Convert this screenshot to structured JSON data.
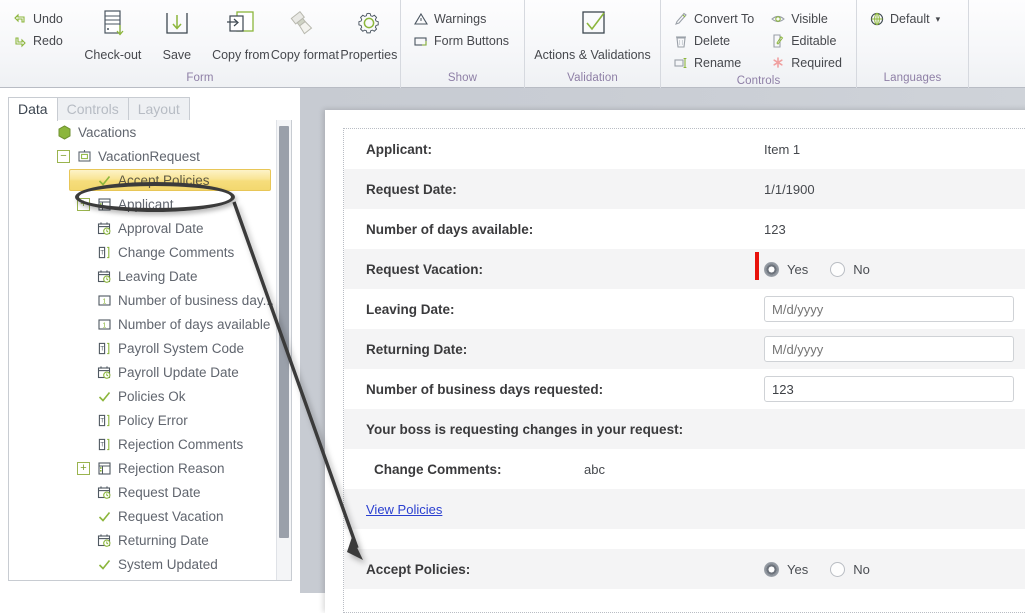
{
  "ribbon": {
    "groups": [
      {
        "caption": "Form",
        "small": [
          {
            "label": "Undo",
            "icon": "undo-icon"
          },
          {
            "label": "Redo",
            "icon": "redo-icon"
          }
        ],
        "big": [
          {
            "label": "Check-out",
            "icon": "check-out-icon"
          },
          {
            "label": "Save",
            "icon": "save-icon"
          },
          {
            "label": "Copy from",
            "icon": "copy-from-icon"
          },
          {
            "label": "Copy format",
            "icon": "copy-format-icon"
          },
          {
            "label": "Properties",
            "icon": "properties-gear-icon"
          }
        ]
      },
      {
        "caption": "Show",
        "small": [
          {
            "label": "Warnings",
            "icon": "warning-triangle-icon"
          },
          {
            "label": "Form Buttons",
            "icon": "form-buttons-icon"
          }
        ],
        "big": []
      },
      {
        "caption": "Validation",
        "small": [],
        "big": [
          {
            "label": "Actions & Validations",
            "icon": "checkmark-box-icon"
          }
        ]
      },
      {
        "caption": "Controls",
        "small": [
          {
            "label": "Convert To",
            "icon": "convert-to-icon"
          },
          {
            "label": "Delete",
            "icon": "trash-icon"
          },
          {
            "label": "Rename",
            "icon": "rename-icon"
          }
        ],
        "small2": [
          {
            "label": "Visible",
            "icon": "eye-icon"
          },
          {
            "label": "Editable",
            "icon": "editable-page-icon"
          },
          {
            "label": "Required",
            "icon": "required-asterisk-icon"
          }
        ],
        "big": []
      },
      {
        "caption": "Languages",
        "small": [
          {
            "label": "Default",
            "icon": "globe-icon",
            "dropdown": "▾"
          }
        ],
        "big": []
      }
    ]
  },
  "left_panel": {
    "tabs": [
      {
        "label": "Data",
        "active": true
      },
      {
        "label": "Controls",
        "active": false
      },
      {
        "label": "Layout",
        "active": false
      }
    ],
    "tree": [
      {
        "label": "Vacations",
        "indent": 0,
        "icon": "entity-hex-icon",
        "expander": "",
        "selected": false
      },
      {
        "label": "VacationRequest",
        "indent": 1,
        "icon": "form-icon",
        "expander": "−",
        "selected": false
      },
      {
        "label": "Accept Policies",
        "indent": 2,
        "icon": "boolean-check-icon",
        "expander": "",
        "selected": true
      },
      {
        "label": "Applicant",
        "indent": 2,
        "icon": "related-entity-icon",
        "expander": "+",
        "selected": false
      },
      {
        "label": "Approval Date",
        "indent": 2,
        "icon": "datetime-icon",
        "expander": "",
        "selected": false
      },
      {
        "label": "Change Comments",
        "indent": 2,
        "icon": "text-icon",
        "expander": "",
        "selected": false
      },
      {
        "label": "Leaving Date",
        "indent": 2,
        "icon": "datetime-icon",
        "expander": "",
        "selected": false
      },
      {
        "label": "Number of business day...",
        "indent": 2,
        "icon": "number-icon",
        "expander": "",
        "selected": false
      },
      {
        "label": "Number of days available",
        "indent": 2,
        "icon": "number-icon",
        "expander": "",
        "selected": false
      },
      {
        "label": "Payroll System Code",
        "indent": 2,
        "icon": "text-icon",
        "expander": "",
        "selected": false
      },
      {
        "label": "Payroll Update Date",
        "indent": 2,
        "icon": "datetime-icon",
        "expander": "",
        "selected": false
      },
      {
        "label": "Policies Ok",
        "indent": 2,
        "icon": "boolean-check-icon",
        "expander": "",
        "selected": false
      },
      {
        "label": "Policy Error",
        "indent": 2,
        "icon": "text-icon",
        "expander": "",
        "selected": false
      },
      {
        "label": "Rejection Comments",
        "indent": 2,
        "icon": "text-icon",
        "expander": "",
        "selected": false
      },
      {
        "label": "Rejection Reason",
        "indent": 2,
        "icon": "related-entity-icon",
        "expander": "+",
        "selected": false
      },
      {
        "label": "Request Date",
        "indent": 2,
        "icon": "datetime-icon",
        "expander": "",
        "selected": false
      },
      {
        "label": "Request Vacation",
        "indent": 2,
        "icon": "boolean-check-icon",
        "expander": "",
        "selected": false
      },
      {
        "label": "Returning Date",
        "indent": 2,
        "icon": "datetime-icon",
        "expander": "",
        "selected": false
      },
      {
        "label": "System Updated",
        "indent": 2,
        "icon": "boolean-check-icon",
        "expander": "",
        "selected": false
      }
    ]
  },
  "form": {
    "rows": [
      {
        "label": "Applicant:",
        "type": "text",
        "value": "Item 1",
        "alt": false
      },
      {
        "label": "Request Date:",
        "type": "text",
        "value": "1/1/1900",
        "alt": true
      },
      {
        "label": "Number of days available:",
        "type": "text",
        "value": "123",
        "alt": false
      },
      {
        "label": "Request Vacation:",
        "type": "radio",
        "selected": "Yes",
        "required": true,
        "alt": true
      },
      {
        "label": "Leaving Date:",
        "type": "input",
        "value": "",
        "placeholder": "M/d/yyyy",
        "alt": false
      },
      {
        "label": "Returning Date:",
        "type": "input",
        "value": "",
        "placeholder": "M/d/yyyy",
        "alt": true
      },
      {
        "label": "Number of business days requested:",
        "type": "input",
        "value": "123",
        "placeholder": "",
        "alt": false
      },
      {
        "label": "Your boss is requesting changes in your request:",
        "type": "none",
        "alt": true
      },
      {
        "label": "Change Comments:",
        "type": "text",
        "value": "abc",
        "indent": true,
        "alt": false
      },
      {
        "label": "View Policies",
        "type": "link",
        "alt": true
      },
      {
        "label": "",
        "type": "spacer",
        "alt": false
      },
      {
        "label": "Accept Policies:",
        "type": "radio",
        "selected": "Yes",
        "required": false,
        "alt": true
      }
    ],
    "radio_options": [
      "Yes",
      "No"
    ]
  },
  "colors": {
    "accent_green": "#8cb63c",
    "highlight_yellow": "#f3d86f",
    "required_red": "#e8120c",
    "link_blue": "#2a3fd0",
    "caption_purple": "#8e7fa6"
  }
}
